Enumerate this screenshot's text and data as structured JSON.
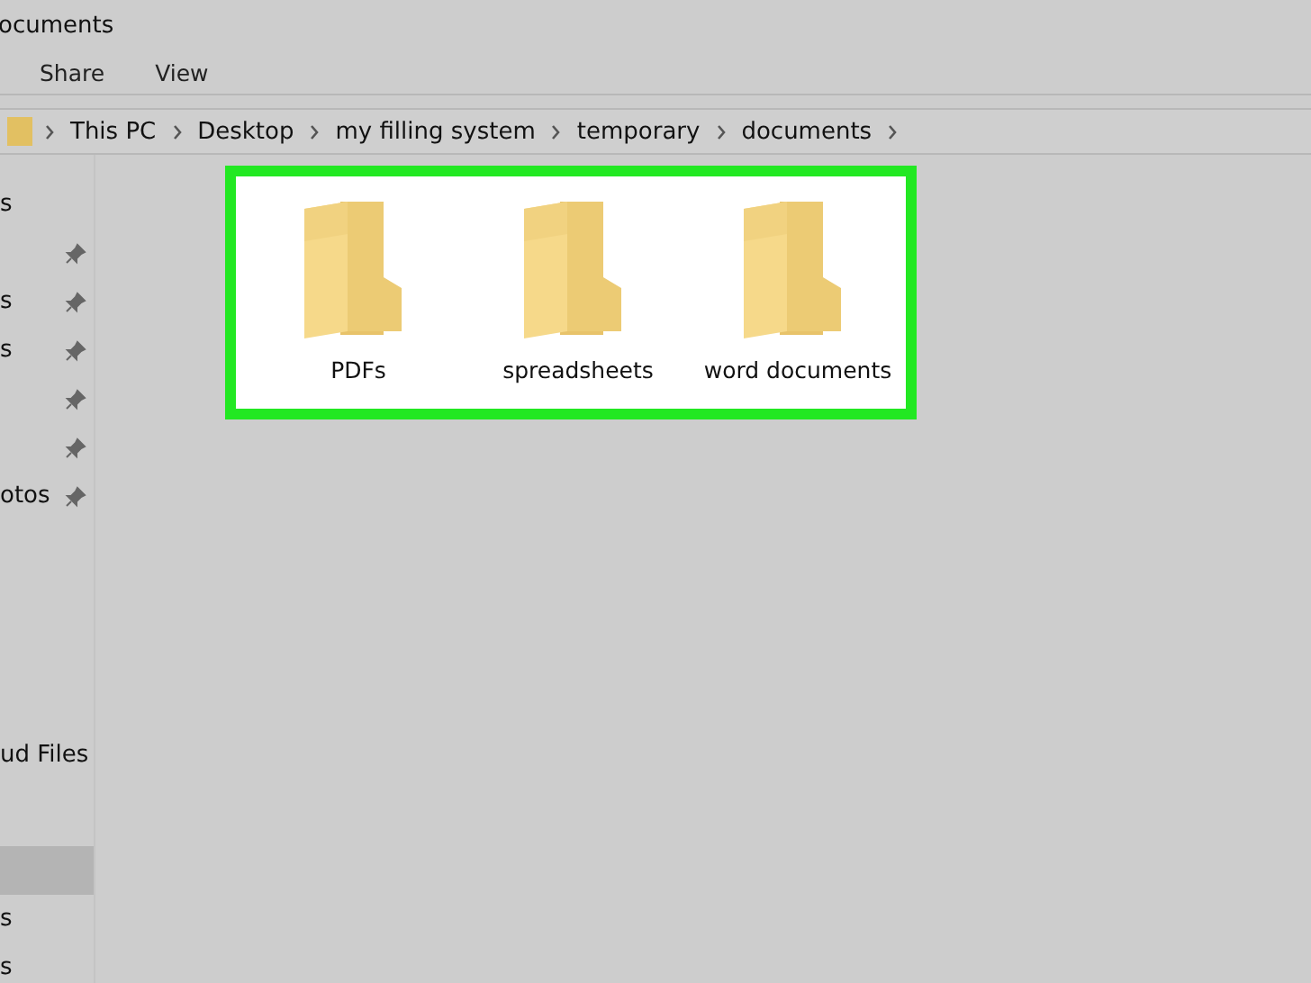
{
  "window": {
    "title": "ocuments"
  },
  "ribbon_tabs": [
    {
      "label": "Share",
      "selected": false
    },
    {
      "label": "View",
      "selected": false
    }
  ],
  "address_bar": {
    "segments": [
      "This PC",
      "Desktop",
      "my filling system",
      "temporary",
      "documents"
    ]
  },
  "sidebar": {
    "groups": [
      [
        {
          "label": "s",
          "pinned": false,
          "selected": false
        },
        {
          "pinned": true,
          "selected": false
        },
        {
          "label": "s",
          "pinned": true,
          "selected": false
        },
        {
          "label": "s",
          "pinned": true,
          "selected": false
        },
        {
          "pinned": true,
          "selected": false
        },
        {
          "pinned": true,
          "selected": false
        },
        {
          "label": "otos",
          "pinned": true,
          "selected": false
        }
      ],
      [
        {
          "label": "ud Files",
          "selected": false
        }
      ],
      [
        {
          "selected": true
        },
        {
          "label": "s",
          "selected": false
        },
        {
          "label": "s",
          "selected": false
        }
      ]
    ]
  },
  "files": {
    "highlighted": true,
    "items": [
      {
        "name": "PDFs",
        "selected": false
      },
      {
        "name": "spreadsheets",
        "selected": false
      },
      {
        "name": "word documents",
        "selected": false
      }
    ]
  }
}
